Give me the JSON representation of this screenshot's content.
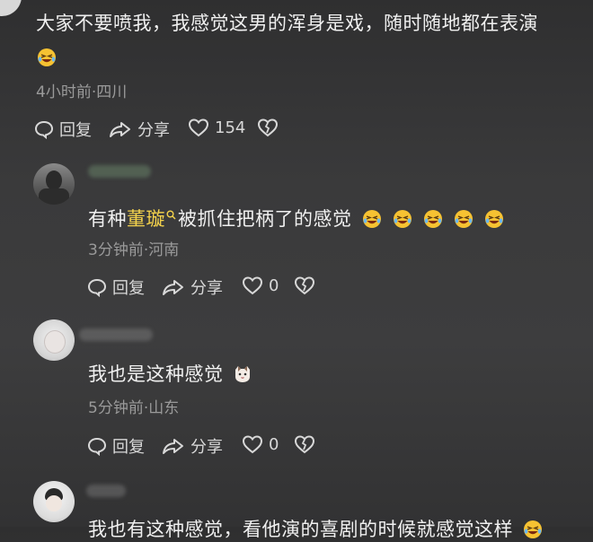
{
  "comments": [
    {
      "text": "大家不要喷我，我感觉这男的浑身是戏，随时随地都在表演",
      "meta": "4小时前·四川",
      "reply_label": "回复",
      "share_label": "分享",
      "likes": "154"
    },
    {
      "text_before": "有种",
      "mention": "董璇",
      "text_after": "被抓住把柄了的感觉",
      "meta": "3分钟前·河南",
      "reply_label": "回复",
      "share_label": "分享",
      "likes": "0"
    },
    {
      "text": "我也是这种感觉",
      "meta": "5分钟前·山东",
      "reply_label": "回复",
      "share_label": "分享",
      "likes": "0"
    },
    {
      "text": "我也有这种感觉，看他演的喜剧的时候就感觉这样"
    }
  ],
  "colors": {
    "background": "#3a3a3b",
    "mention": "#f5d34c",
    "meta": "#9a9a9a"
  },
  "icons": [
    "comment-icon",
    "share-icon",
    "heart-icon",
    "dislike-heart-icon",
    "laughing-emoji-icon",
    "cat-emoji-icon",
    "search-icon"
  ]
}
